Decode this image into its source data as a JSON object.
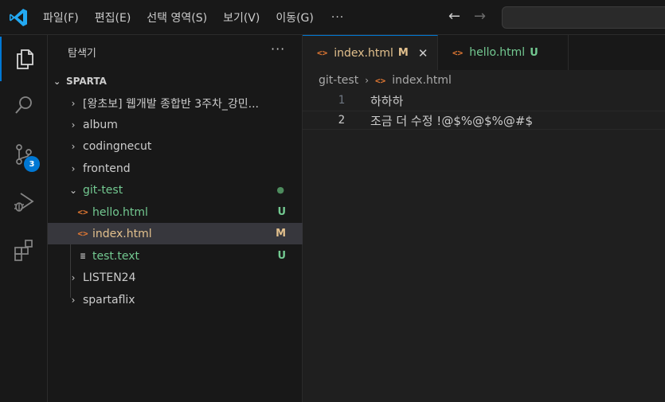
{
  "menu": {
    "file": "파일(F)",
    "edit": "편집(E)",
    "selection": "선택 영역(S)",
    "view": "보기(V)",
    "go": "이동(G)",
    "more": "···"
  },
  "activity": {
    "scm_badge": "3"
  },
  "explorer": {
    "title": "탐색기",
    "more": "···",
    "root": "SPARTA",
    "items": [
      {
        "label": "[왕초보] 웹개발 종합반 3주차_강민..."
      },
      {
        "label": "album"
      },
      {
        "label": "codingnecut"
      },
      {
        "label": "frontend"
      },
      {
        "label": "git-test",
        "status": "●"
      },
      {
        "label": "hello.html",
        "status": "U"
      },
      {
        "label": "index.html",
        "status": "M"
      },
      {
        "label": "test.text",
        "status": "U"
      },
      {
        "label": "LISTEN24"
      },
      {
        "label": "spartaflix"
      }
    ]
  },
  "tabs": [
    {
      "label": "index.html",
      "status": "M",
      "close": "✕"
    },
    {
      "label": "hello.html",
      "status": "U"
    }
  ],
  "breadcrumb": {
    "folder": "git-test",
    "file": "index.html"
  },
  "editor": {
    "lines": [
      {
        "num": "1",
        "text": "하하하"
      },
      {
        "num": "2",
        "text": "조금 더 수정 !@$%@$%@#$"
      }
    ]
  },
  "colors": {
    "accent": "#0078d4",
    "untracked": "#73c991",
    "modified": "#e2c08d",
    "html_icon": "#e37933"
  }
}
